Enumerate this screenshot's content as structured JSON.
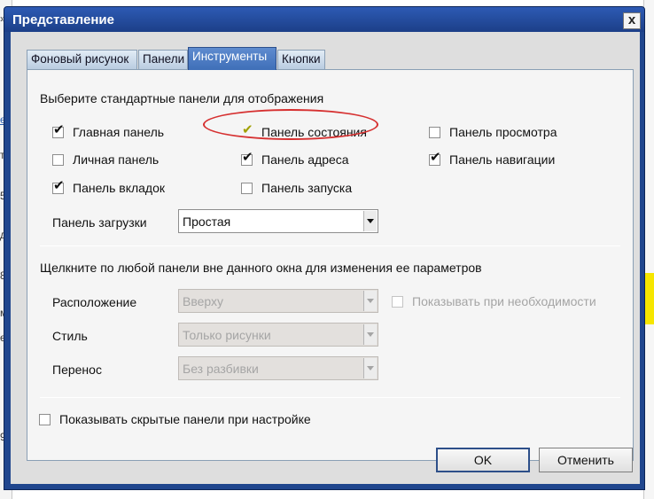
{
  "dialog": {
    "title": "Представление",
    "close_label": "x"
  },
  "tabs": [
    {
      "label": "Фоновый рисунок",
      "active": false
    },
    {
      "label": "Панели",
      "active": false
    },
    {
      "label": "Инструменты",
      "active": true
    },
    {
      "label": "Кнопки",
      "active": false
    }
  ],
  "section1": {
    "heading": "Выберите стандартные панели для отображения",
    "checkboxes": [
      {
        "label": "Главная панель",
        "checked": true
      },
      {
        "label": "Панель состояния",
        "checked": true
      },
      {
        "label": "Панель просмотра",
        "checked": false
      },
      {
        "label": "Личная панель",
        "checked": false
      },
      {
        "label": "Панель адреса",
        "checked": true
      },
      {
        "label": "Панель навигации",
        "checked": true
      },
      {
        "label": "Панель вкладок",
        "checked": true
      },
      {
        "label": "Панель запуска",
        "checked": false
      }
    ],
    "load_panel": {
      "label": "Панель загрузки",
      "value": "Простая"
    }
  },
  "section2": {
    "heading": "Щелкните по любой панели вне данного окна для изменения ее параметров",
    "position": {
      "label": "Расположение",
      "value": "Вверху"
    },
    "style": {
      "label": "Стиль",
      "value": "Только рисунки"
    },
    "wrap": {
      "label": "Перенос",
      "value": "Без разбивки"
    },
    "show_when_needed": {
      "label": "Показывать при необходимости",
      "checked": false
    }
  },
  "show_hidden": {
    "label": "Показывать скрытые панели при настройке",
    "checked": false
  },
  "buttons": {
    "ok": "OK",
    "cancel": "Отменить"
  },
  "background": {
    "left_fragments": [
      "»",
      "ет",
      "то",
      "5",
      "д",
      "8",
      "м",
      "ет",
      "9"
    ]
  }
}
